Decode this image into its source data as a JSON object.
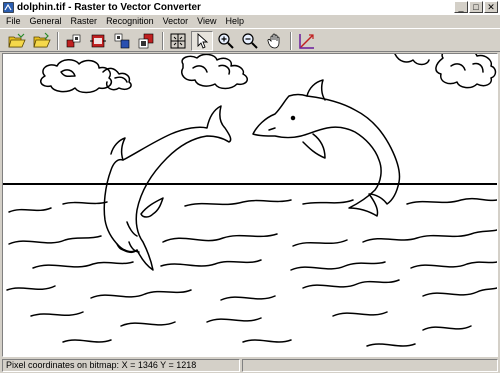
{
  "window": {
    "title": "dolphin.tif - Raster to Vector Converter",
    "controls": {
      "minimize": "_",
      "maximize": "□",
      "close": "✕"
    }
  },
  "menu": {
    "items": [
      {
        "label": "File"
      },
      {
        "label": "General"
      },
      {
        "label": "Raster"
      },
      {
        "label": "Recognition"
      },
      {
        "label": "Vector"
      },
      {
        "label": "View"
      },
      {
        "label": "Help"
      }
    ]
  },
  "toolbar": {
    "buttons": [
      {
        "icon": "open-folder-icon"
      },
      {
        "icon": "open-folder-alt-icon"
      },
      {
        "icon": "raster-tool-1-icon"
      },
      {
        "icon": "raster-tool-2-icon"
      },
      {
        "icon": "raster-tool-3-icon"
      },
      {
        "icon": "raster-tool-4-icon"
      },
      {
        "icon": "fit-view-icon"
      },
      {
        "icon": "pointer-icon",
        "pressed": true
      },
      {
        "icon": "zoom-in-icon"
      },
      {
        "icon": "zoom-out-icon"
      },
      {
        "icon": "pan-hand-icon"
      },
      {
        "icon": "vectorize-icon"
      }
    ]
  },
  "status": {
    "coords": "Pixel coordinates on bitmap:  X = 1346  Y = 1218"
  },
  "colors": {
    "chrome": "#d4d0c8",
    "canvas": "#ffffff",
    "accent_vector": "#6a1b9a"
  }
}
